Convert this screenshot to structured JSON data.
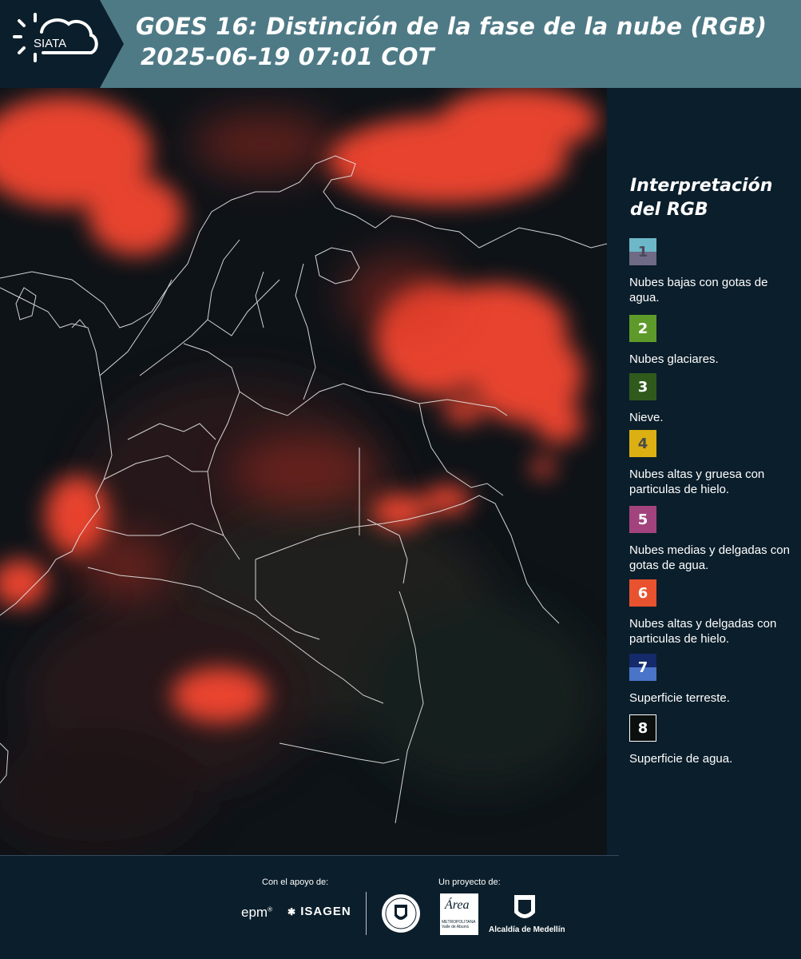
{
  "header": {
    "logo_text": "SIATA",
    "title_line1": "GOES 16: Distinción de la fase de la nube (RGB)",
    "title_line2": "2025-06-19 07:01 COT"
  },
  "legend": {
    "title": "Interpretación del RGB",
    "items": [
      {
        "number": "1",
        "label": "Nubes bajas con gotas de agua.",
        "color_top": "#6db8c8",
        "color_bottom": "#6f6a85",
        "number_color": "#4a4a5a"
      },
      {
        "number": "2",
        "label": "Nubes glaciares.",
        "color_top": "#5e9a2a",
        "color_bottom": "#5e9a2a",
        "number_color": "#ffffff"
      },
      {
        "number": "3",
        "label": "Nieve.",
        "color_top": "#2f5a1c",
        "color_bottom": "#2f5a1c",
        "number_color": "#ffffff"
      },
      {
        "number": "4",
        "label": "Nubes altas y gruesa con particulas de hielo.",
        "color_top": "#dcb012",
        "color_bottom": "#dcb012",
        "number_color": "#4a4a4a"
      },
      {
        "number": "5",
        "label": "Nubes medias y delgadas con gotas de agua.",
        "color_top": "#a3437e",
        "color_bottom": "#a3437e",
        "number_color": "#ffffff"
      },
      {
        "number": "6",
        "label": "Nubes altas y delgadas con particulas de hielo.",
        "color_top": "#e8522e",
        "color_bottom": "#e8522e",
        "number_color": "#ffffff"
      },
      {
        "number": "7",
        "label": "Superficie terreste.",
        "color_top": "#152a6a",
        "color_bottom": "#4a74c8",
        "number_color": "#ffffff"
      },
      {
        "number": "8",
        "label": "Superficie de agua.",
        "color_top": "#0b0f0d",
        "color_bottom": "#0b0f0d",
        "number_color": "#ffffff"
      }
    ]
  },
  "footer": {
    "support_label": "Con el apoyo de:",
    "project_label": "Un proyecto de:",
    "sponsors": [
      "epm",
      "ISAGEN"
    ],
    "partners": [
      "METROPOLITANA Valle de Aburrá",
      "Alcaldía de Medellín"
    ],
    "area_text": "Área"
  },
  "colors": {
    "background": "#0b1e2b",
    "header_band": "#4e7a86",
    "cloud_red": "#ff5a3c"
  }
}
